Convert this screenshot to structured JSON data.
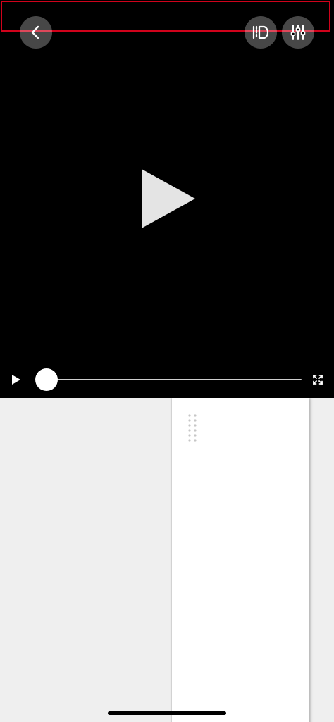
{
  "player": {
    "state": "paused",
    "progress": 0,
    "controls": {
      "back_icon": "chevron-left-icon",
      "mirror_icon": "mirror-flip-icon",
      "adjust_icon": "sliders-icon",
      "play_icon": "play-icon",
      "fullscreen_icon": "expand-icon"
    }
  },
  "colors": {
    "player_background": "#000000",
    "page_background": "#efefef",
    "sheet_background": "#ffffff",
    "highlight_border": "#d0021b"
  }
}
